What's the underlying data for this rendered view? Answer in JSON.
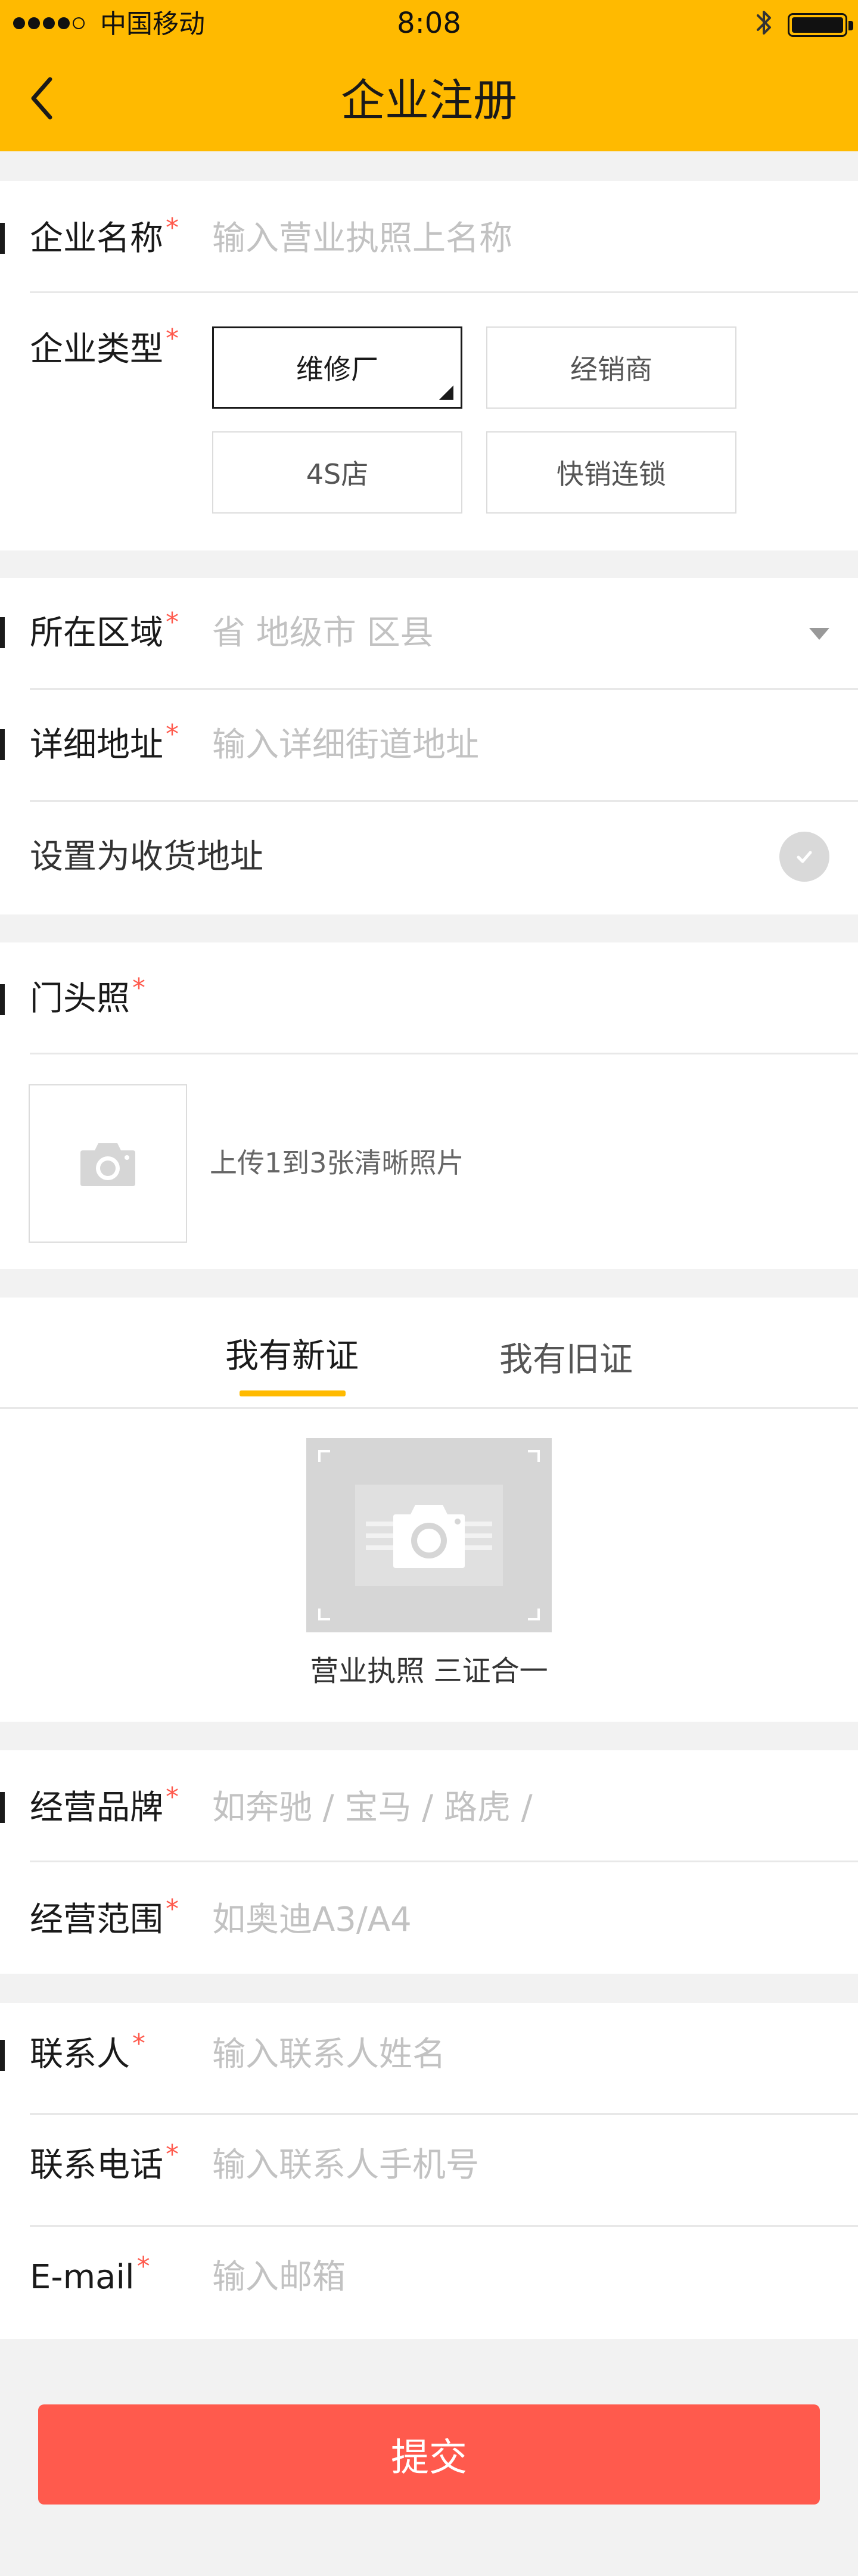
{
  "status_bar": {
    "carrier": "中国移动",
    "time": "8:08",
    "signal_bars_filled": 4,
    "signal_bars_total": 5,
    "battery_level": 1.0
  },
  "nav": {
    "title": "企业注册",
    "back_icon": "chevron-left-icon"
  },
  "required_mark": "*",
  "company": {
    "name_label": "企业名称",
    "name_placeholder": "输入营业执照上名称",
    "type_label": "企业类型",
    "types": [
      "维修厂",
      "经销商",
      "4S店",
      "快销连锁"
    ],
    "selected_type": "维修厂"
  },
  "location": {
    "region_label": "所在区域",
    "region_placeholder": "省 地级市 区县",
    "address_label": "详细地址",
    "address_placeholder": "输入详细街道地址",
    "set_shipping_label": "设置为收货地址"
  },
  "storefront": {
    "label": "门头照",
    "upload_hint": "上传1到3张清晰照片",
    "icon": "camera-icon"
  },
  "license": {
    "tabs": [
      "我有新证",
      "我有旧证"
    ],
    "active_tab": "我有新证",
    "caption": "营业执照 三证合一"
  },
  "business": {
    "brand_label": "经营品牌",
    "brand_placeholder": "如奔驰 / 宝马 / 路虎 /",
    "scope_label": "经营范围",
    "scope_placeholder": "如奥迪A3/A4"
  },
  "contact": {
    "person_label": "联系人",
    "person_placeholder": "输入联系人姓名",
    "phone_label": "联系电话",
    "phone_placeholder": "输入联系人手机号",
    "email_label": "E-mail",
    "email_placeholder": "输入邮箱"
  },
  "submit_label": "提交",
  "colors": {
    "brand": "#ffba00",
    "required": "#ff5a4d",
    "submit": "#ff5a4d",
    "placeholder": "#c2c2c2"
  }
}
